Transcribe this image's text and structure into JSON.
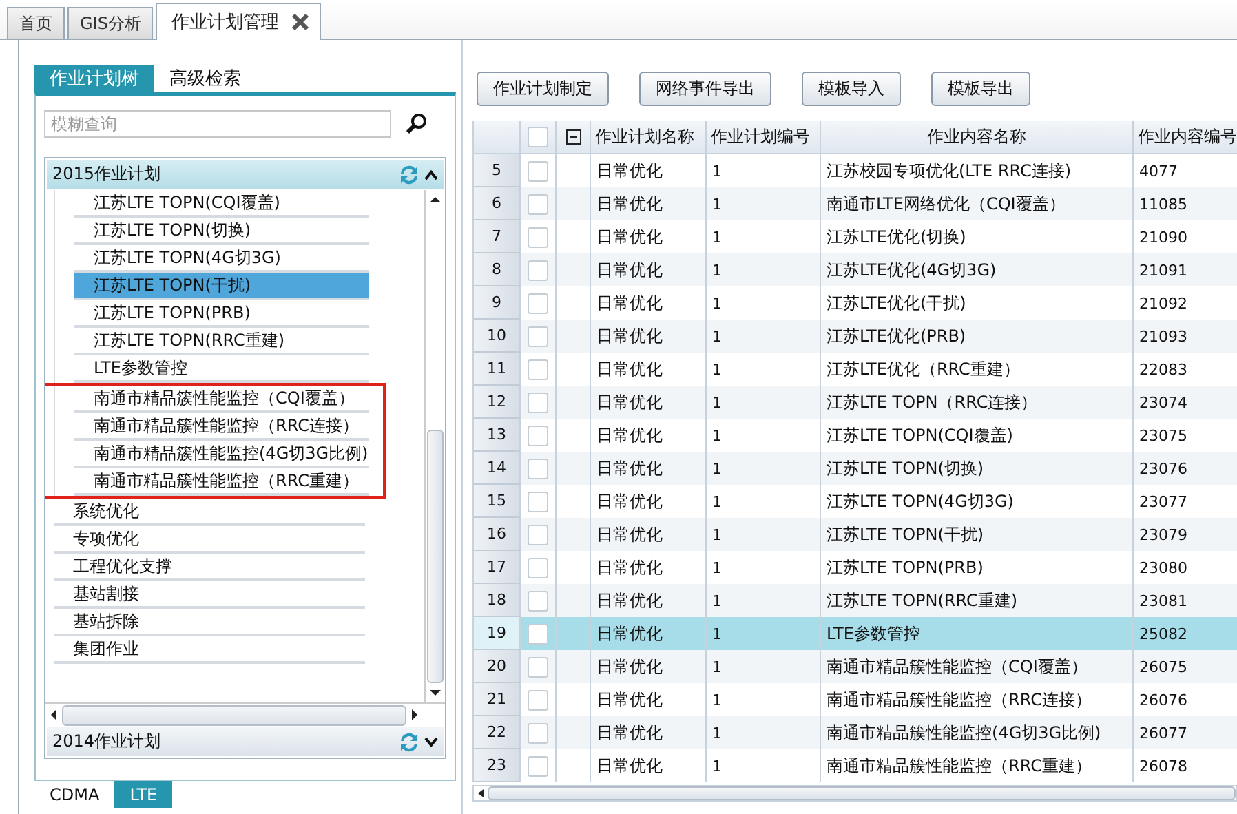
{
  "tabs": [
    {
      "label": "首页",
      "selected": false,
      "closable": false
    },
    {
      "label": "GIS分析",
      "selected": false,
      "closable": false
    },
    {
      "label": "作业计划管理",
      "selected": true,
      "closable": true
    }
  ],
  "left_panel": {
    "tabs": [
      {
        "label": "作业计划树",
        "selected": true
      },
      {
        "label": "高级检索",
        "selected": false
      }
    ],
    "search": {
      "placeholder": "模糊查询"
    },
    "groups": [
      {
        "title": "2015作业计划",
        "expanded": true,
        "items": [
          {
            "kind": "branch",
            "children": [
              {
                "kind": "item",
                "label": "江苏LTE TOPN(CQI覆盖)",
                "selected": false
              },
              {
                "kind": "item",
                "label": "江苏LTE TOPN(切换)",
                "selected": false
              },
              {
                "kind": "item",
                "label": "江苏LTE TOPN(4G切3G)",
                "selected": false
              },
              {
                "kind": "item",
                "label": "江苏LTE TOPN(干扰)",
                "selected": true
              },
              {
                "kind": "item",
                "label": "江苏LTE TOPN(PRB)",
                "selected": false
              },
              {
                "kind": "item",
                "label": "江苏LTE TOPN(RRC重建)",
                "selected": false
              },
              {
                "kind": "item",
                "label": "LTE参数管控",
                "selected": false
              },
              {
                "kind": "annotation_box",
                "children": [
                  {
                    "kind": "item",
                    "label": "南通市精品簇性能监控（CQI覆盖）",
                    "selected": false
                  },
                  {
                    "kind": "item",
                    "label": "南通市精品簇性能监控（RRC连接）",
                    "selected": false
                  },
                  {
                    "kind": "item",
                    "label": "南通市精品簇性能监控(4G切3G比例)",
                    "selected": false
                  },
                  {
                    "kind": "item",
                    "label": "南通市精品簇性能监控（RRC重建）",
                    "selected": false
                  }
                ]
              }
            ]
          },
          {
            "kind": "item",
            "label": "系统优化",
            "selected": false
          },
          {
            "kind": "item",
            "label": "专项优化",
            "selected": false
          },
          {
            "kind": "item",
            "label": "工程优化支撑",
            "selected": false
          },
          {
            "kind": "item",
            "label": "基站割接",
            "selected": false
          },
          {
            "kind": "item",
            "label": "基站拆除",
            "selected": false
          },
          {
            "kind": "item",
            "label": "集团作业",
            "selected": false
          }
        ]
      },
      {
        "title": "2014作业计划",
        "expanded": false
      }
    ],
    "bottom_tabs": [
      {
        "label": "CDMA",
        "selected": false
      },
      {
        "label": "LTE",
        "selected": true
      }
    ]
  },
  "toolbar": {
    "buttons": [
      "作业计划制定",
      "网络事件导出",
      "模板导入",
      "模板导出"
    ]
  },
  "table": {
    "select_all": {
      "checked": false
    },
    "columns": [
      "作业计划名称",
      "作业计划编号",
      "作业内容名称",
      "作业内容编号"
    ],
    "rows": [
      {
        "number": "5",
        "checked": false,
        "selected": false,
        "cells": [
          "日常优化",
          "1",
          "江苏校园专项优化(LTE RRC连接)",
          "4077"
        ]
      },
      {
        "number": "6",
        "checked": false,
        "selected": false,
        "cells": [
          "日常优化",
          "1",
          "南通市LTE网络优化（CQI覆盖）",
          "11085"
        ]
      },
      {
        "number": "7",
        "checked": false,
        "selected": false,
        "cells": [
          "日常优化",
          "1",
          "江苏LTE优化(切换)",
          "21090"
        ]
      },
      {
        "number": "8",
        "checked": false,
        "selected": false,
        "cells": [
          "日常优化",
          "1",
          "江苏LTE优化(4G切3G)",
          "21091"
        ]
      },
      {
        "number": "9",
        "checked": false,
        "selected": false,
        "cells": [
          "日常优化",
          "1",
          "江苏LTE优化(干扰)",
          "21092"
        ]
      },
      {
        "number": "10",
        "checked": false,
        "selected": false,
        "cells": [
          "日常优化",
          "1",
          "江苏LTE优化(PRB)",
          "21093"
        ]
      },
      {
        "number": "11",
        "checked": false,
        "selected": false,
        "cells": [
          "日常优化",
          "1",
          "江苏LTE优化（RRC重建）",
          "22083"
        ]
      },
      {
        "number": "12",
        "checked": false,
        "selected": false,
        "cells": [
          "日常优化",
          "1",
          "江苏LTE TOPN（RRC连接）",
          "23074"
        ]
      },
      {
        "number": "13",
        "checked": false,
        "selected": false,
        "cells": [
          "日常优化",
          "1",
          "江苏LTE TOPN(CQI覆盖)",
          "23075"
        ]
      },
      {
        "number": "14",
        "checked": false,
        "selected": false,
        "cells": [
          "日常优化",
          "1",
          "江苏LTE TOPN(切换)",
          "23076"
        ]
      },
      {
        "number": "15",
        "checked": false,
        "selected": false,
        "cells": [
          "日常优化",
          "1",
          "江苏LTE TOPN(4G切3G)",
          "23077"
        ]
      },
      {
        "number": "16",
        "checked": false,
        "selected": false,
        "cells": [
          "日常优化",
          "1",
          "江苏LTE TOPN(干扰)",
          "23079"
        ]
      },
      {
        "number": "17",
        "checked": false,
        "selected": false,
        "cells": [
          "日常优化",
          "1",
          "江苏LTE TOPN(PRB)",
          "23080"
        ]
      },
      {
        "number": "18",
        "checked": false,
        "selected": false,
        "cells": [
          "日常优化",
          "1",
          "江苏LTE TOPN(RRC重建)",
          "23081"
        ]
      },
      {
        "number": "19",
        "checked": false,
        "selected": true,
        "cells": [
          "日常优化",
          "1",
          "LTE参数管控",
          "25082"
        ]
      },
      {
        "number": "20",
        "checked": false,
        "selected": false,
        "cells": [
          "日常优化",
          "1",
          "南通市精品簇性能监控（CQI覆盖）",
          "26075"
        ]
      },
      {
        "number": "21",
        "checked": false,
        "selected": false,
        "cells": [
          "日常优化",
          "1",
          "南通市精品簇性能监控（RRC连接）",
          "26076"
        ]
      },
      {
        "number": "22",
        "checked": false,
        "selected": false,
        "cells": [
          "日常优化",
          "1",
          "南通市精品簇性能监控(4G切3G比例)",
          "26077"
        ]
      },
      {
        "number": "23",
        "checked": false,
        "selected": false,
        "cells": [
          "日常优化",
          "1",
          "南通市精品簇性能监控（RRC重建）",
          "26078"
        ]
      }
    ]
  }
}
